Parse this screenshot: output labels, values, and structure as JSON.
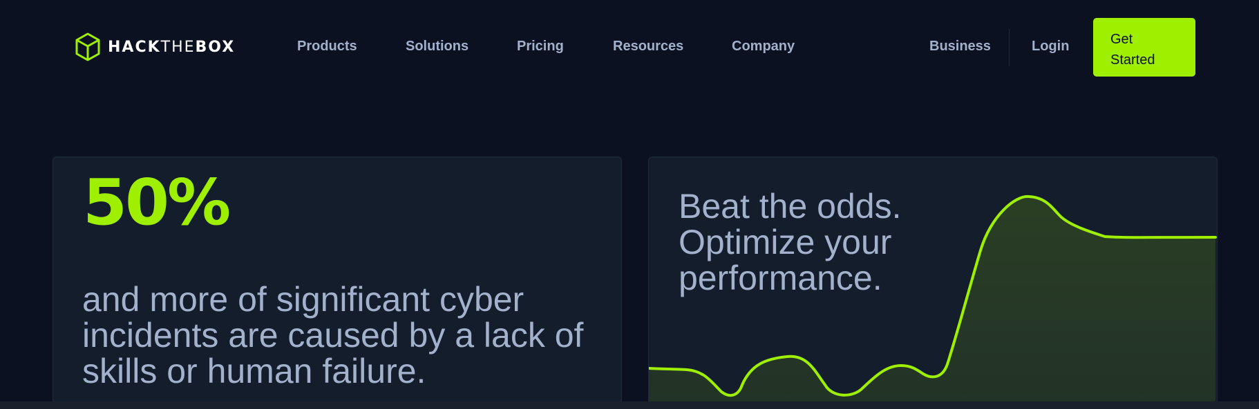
{
  "header": {
    "logo_text_bold1": "HACK",
    "logo_text_thin": "THE",
    "logo_text_bold2": "BOX",
    "logo_icon": "cube-icon",
    "nav_items": [
      "Products",
      "Solutions",
      "Pricing",
      "Resources",
      "Company"
    ],
    "business_label": "Business",
    "login_label": "Login",
    "cta_label": "Get Started"
  },
  "stat_card": {
    "value": "50%",
    "description": "and more of significant cyber incidents are caused by a lack of skills or human failure."
  },
  "performance_card": {
    "heading": "Beat the odds. Optimize your performance."
  },
  "colors": {
    "background": "#0b1120",
    "card": "#141d2b",
    "accent": "#9fef00",
    "text_muted": "#a4b1cd"
  }
}
